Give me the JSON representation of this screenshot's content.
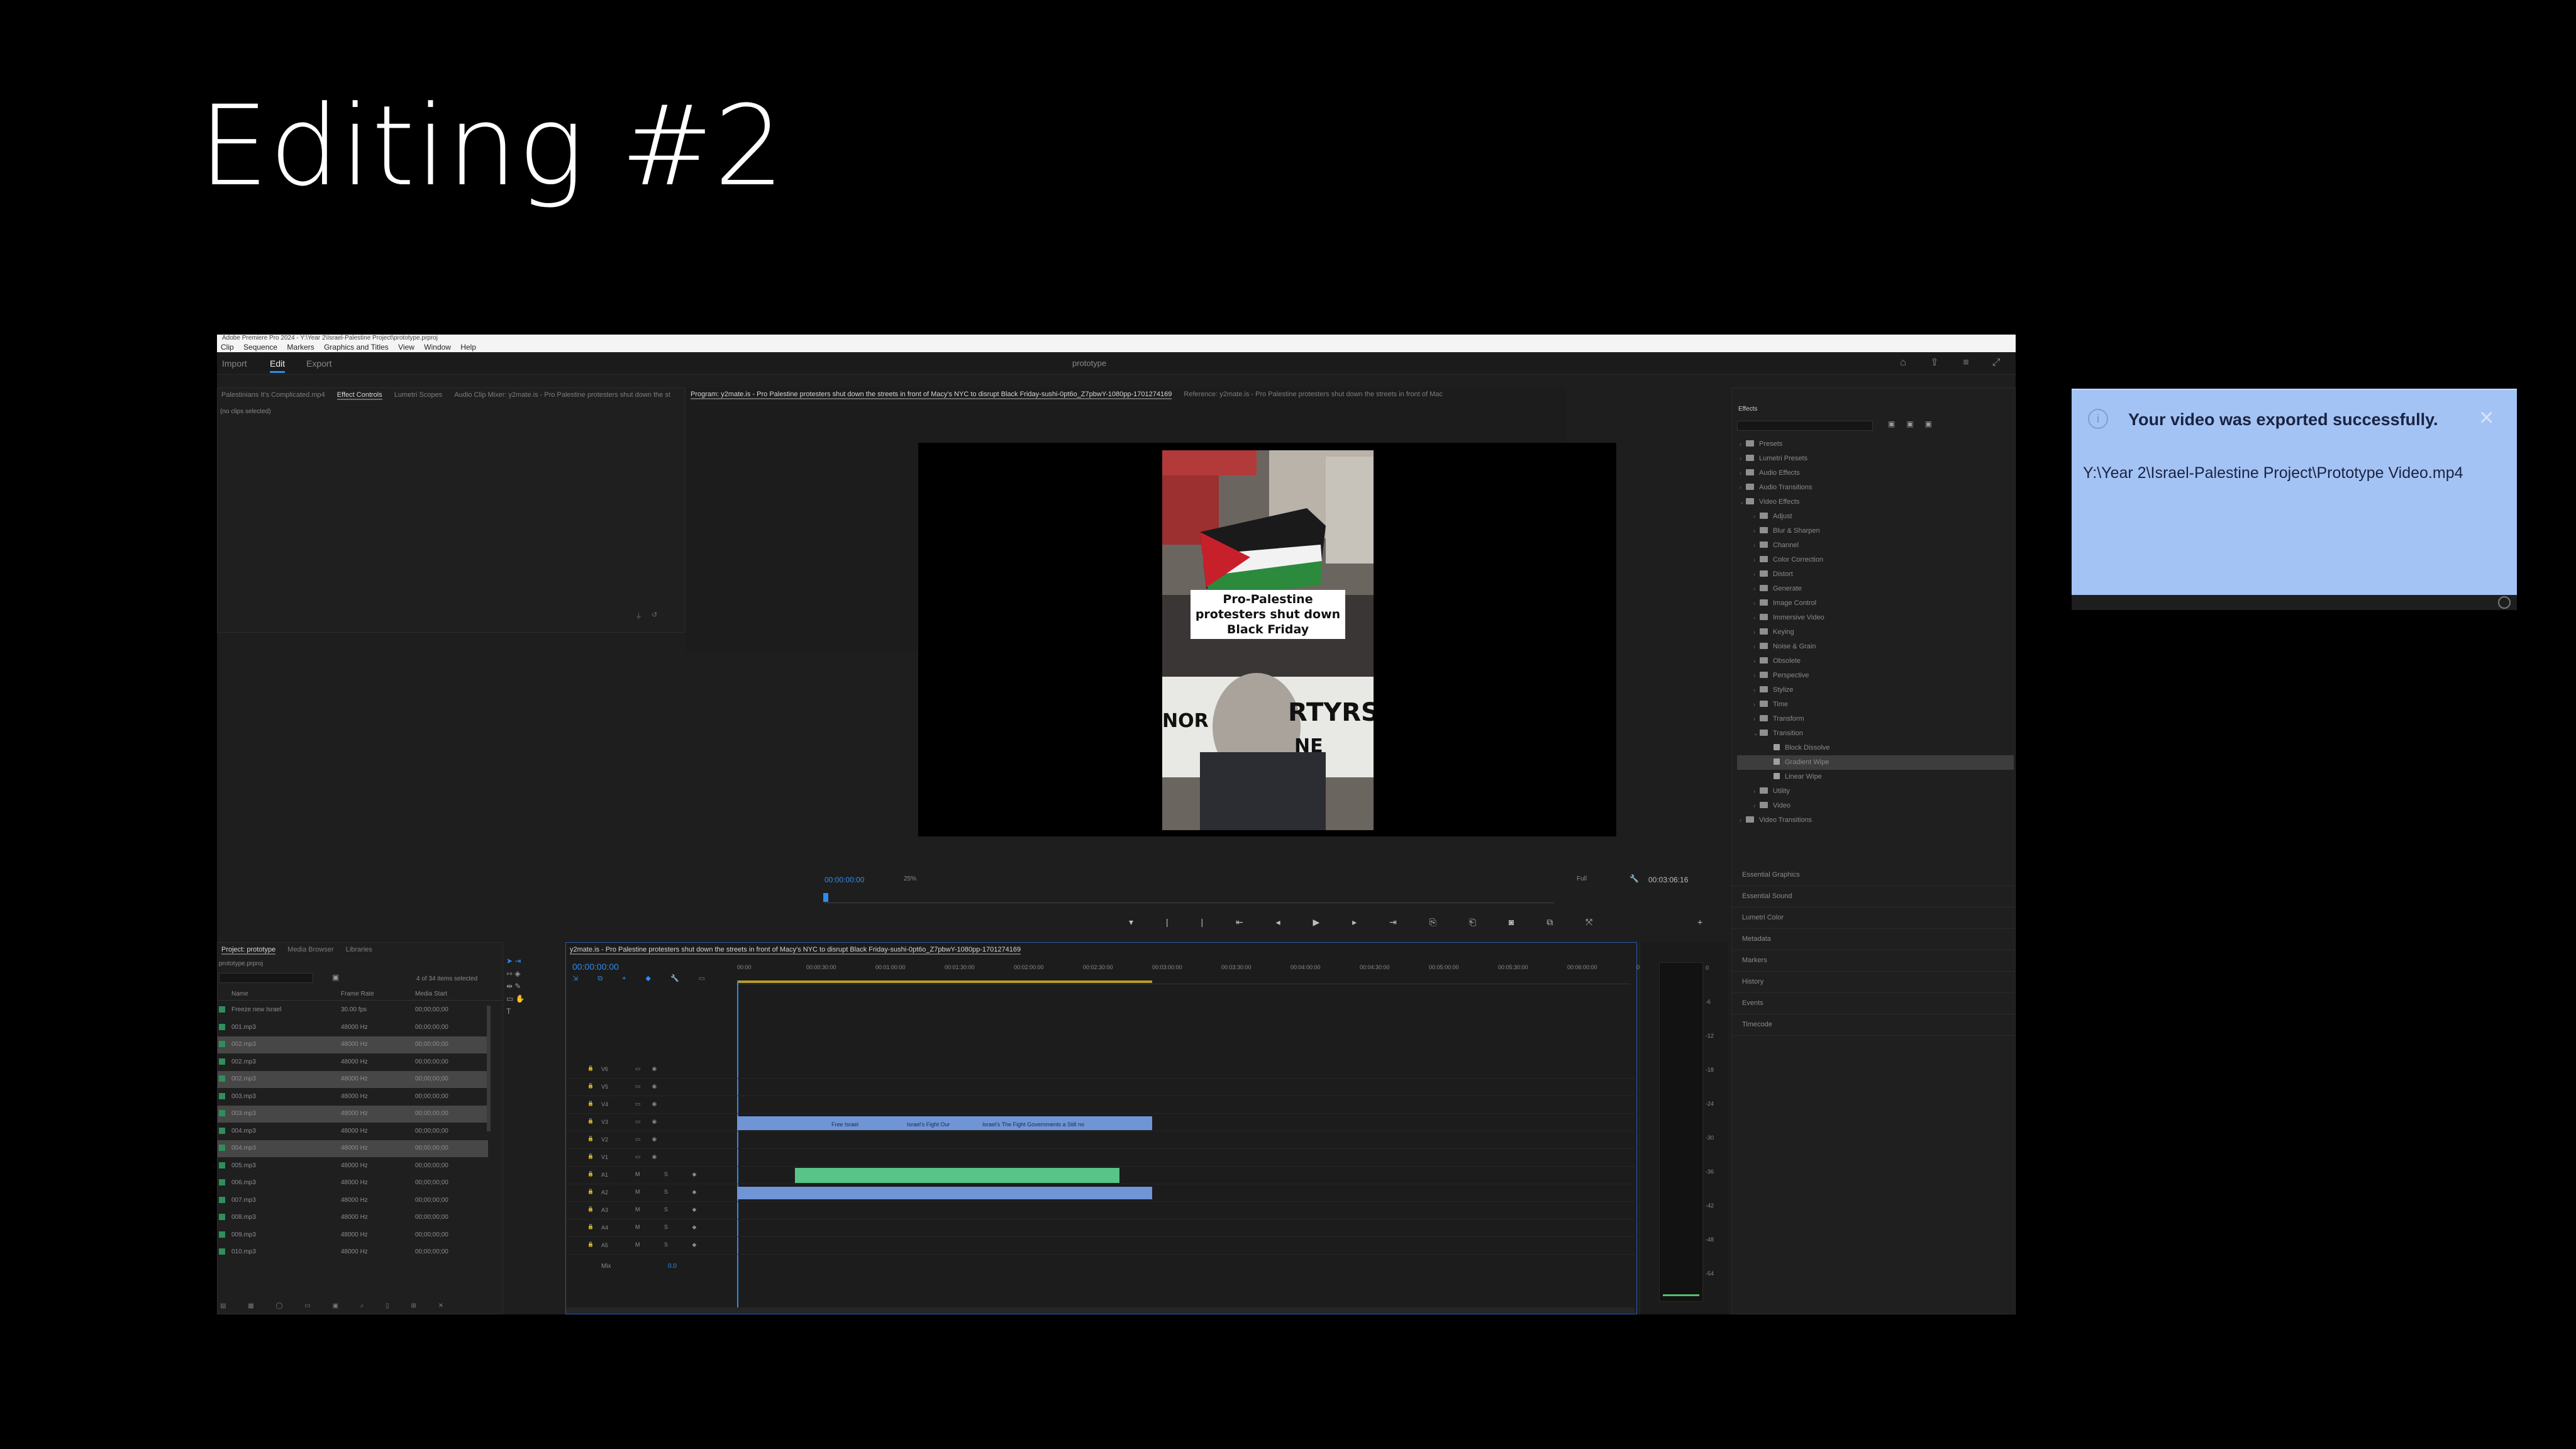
{
  "slide": {
    "title": "Editing #2"
  },
  "app": {
    "title_bar": "Adobe Premiere Pro 2024 - Y:\\Year 2\\Israel-Palestine Project\\prototype.prproj",
    "menu": [
      "Clip",
      "Sequence",
      "Markers",
      "Graphics and Titles",
      "View",
      "Window",
      "Help"
    ],
    "workspace_tabs": [
      "Import",
      "Edit",
      "Export"
    ],
    "active_workspace": "Edit",
    "project_name": "prototype"
  },
  "source_panel": {
    "tabs": [
      "Palestinians It's Complicated.mp4",
      "Effect Controls",
      "Lumetri Scopes",
      "Audio Clip Mixer: y2mate.is - Pro Palestine protesters shut down the st"
    ],
    "active_tab": "Effect Controls",
    "master_label": "(no clips selected)"
  },
  "program": {
    "tabs": [
      "Program: y2mate.is - Pro Palestine protesters shut down the streets in front of Macy's NYC to disrupt Black Friday-sushi-0pt6o_Z7pbwY-1080pp-1701274169",
      "Reference: y2mate.is - Pro Palestine protesters shut down the streets in front of Mac"
    ],
    "caption": "Pro-Palestine protesters shut down Black Friday",
    "timecode_current": "00:00:00:00",
    "zoom": "25%",
    "quality": "Full",
    "duration": "00:03:06:16"
  },
  "project_panel": {
    "tabs": [
      "Project: prototype",
      "Media Browser",
      "Libraries"
    ],
    "project_file": "prototype.prproj",
    "selection_info": "4 of 34 items selected",
    "columns": [
      "Name",
      "Frame Rate",
      "Media Start"
    ],
    "items": [
      {
        "name": "Freeze new Israel",
        "rate": "30.00 fps",
        "start": "00;00;00;00",
        "selected": false,
        "color": "#2f8f5b"
      },
      {
        "name": "001.mp3",
        "rate": "48000 Hz",
        "start": "00;00;00;00",
        "selected": false,
        "color": "#2f8f5b"
      },
      {
        "name": "002.mp3",
        "rate": "48000 Hz",
        "start": "00;00;00;00",
        "selected": true,
        "color": "#2f8f5b"
      },
      {
        "name": "002.mp3",
        "rate": "48000 Hz",
        "start": "00;00;00;00",
        "selected": false,
        "color": "#2f8f5b"
      },
      {
        "name": "002.mp3",
        "rate": "48000 Hz",
        "start": "00;00;00;00",
        "selected": true,
        "color": "#2f8f5b"
      },
      {
        "name": "003.mp3",
        "rate": "48000 Hz",
        "start": "00;00;00;00",
        "selected": false,
        "color": "#2f8f5b"
      },
      {
        "name": "003.mp3",
        "rate": "48000 Hz",
        "start": "00;00;00;00",
        "selected": true,
        "color": "#2f8f5b"
      },
      {
        "name": "004.mp3",
        "rate": "48000 Hz",
        "start": "00;00;00;00",
        "selected": false,
        "color": "#2f8f5b"
      },
      {
        "name": "004.mp3",
        "rate": "48000 Hz",
        "start": "00;00;00;00",
        "selected": true,
        "color": "#2f8f5b"
      },
      {
        "name": "005.mp3",
        "rate": "48000 Hz",
        "start": "00;00;00;00",
        "selected": false,
        "color": "#2f8f5b"
      },
      {
        "name": "006.mp3",
        "rate": "48000 Hz",
        "start": "00;00;00;00",
        "selected": false,
        "color": "#2f8f5b"
      },
      {
        "name": "007.mp3",
        "rate": "48000 Hz",
        "start": "00;00;00;00",
        "selected": false,
        "color": "#2f8f5b"
      },
      {
        "name": "008.mp3",
        "rate": "48000 Hz",
        "start": "00;00;00;00",
        "selected": false,
        "color": "#2f8f5b"
      },
      {
        "name": "009.mp3",
        "rate": "48000 Hz",
        "start": "00;00;00;00",
        "selected": false,
        "color": "#2f8f5b"
      },
      {
        "name": "010.mp3",
        "rate": "48000 Hz",
        "start": "00;00;00;00",
        "selected": false,
        "color": "#2f8f5b"
      }
    ]
  },
  "timeline": {
    "tab": "y2mate.is - Pro Palestine protesters shut down the streets in front of Macy's NYC to disrupt Black Friday-sushi-0pt6o_Z7pbwY-1080pp-1701274169",
    "timecode": "00:00:00:00",
    "ruler": [
      "00:00",
      "00:00:30:00",
      "00:01:00:00",
      "00:01:30:00",
      "00:02:00:00",
      "00:02:30:00",
      "00:03:00:00",
      "00:03:30:00",
      "00:04:00:00",
      "00:04:30:00",
      "00:05:00:00",
      "00:05:30:00",
      "00:06:00:00",
      "00:0"
    ],
    "video_tracks": [
      "V6",
      "V5",
      "V4",
      "V3",
      "V2",
      "V1"
    ],
    "audio_tracks": [
      "A1",
      "A2",
      "A3",
      "A4",
      "A5"
    ],
    "mix_label": "Mix",
    "mix_value": "0.0",
    "clip_labels": [
      "Free Israel",
      "Israel's Fight Our",
      "Israel's The Fight Governments a Still no"
    ],
    "clip_color_video": "#6f95d6",
    "clip_color_audio": "#58c488"
  },
  "effects": {
    "title": "Effects",
    "tree": [
      {
        "label": "Presets",
        "level": 0,
        "open": false
      },
      {
        "label": "Lumetri Presets",
        "level": 0,
        "open": false
      },
      {
        "label": "Audio Effects",
        "level": 0,
        "open": false
      },
      {
        "label": "Audio Transitions",
        "level": 0,
        "open": false
      },
      {
        "label": "Video Effects",
        "level": 0,
        "open": true
      },
      {
        "label": "Adjust",
        "level": 1,
        "open": false
      },
      {
        "label": "Blur & Sharpen",
        "level": 1,
        "open": false
      },
      {
        "label": "Channel",
        "level": 1,
        "open": false
      },
      {
        "label": "Color Correction",
        "level": 1,
        "open": false
      },
      {
        "label": "Distort",
        "level": 1,
        "open": false
      },
      {
        "label": "Generate",
        "level": 1,
        "open": false
      },
      {
        "label": "Image Control",
        "level": 1,
        "open": false
      },
      {
        "label": "Immersive Video",
        "level": 1,
        "open": false
      },
      {
        "label": "Keying",
        "level": 1,
        "open": false
      },
      {
        "label": "Noise & Grain",
        "level": 1,
        "open": false
      },
      {
        "label": "Obsolete",
        "level": 1,
        "open": false
      },
      {
        "label": "Perspective",
        "level": 1,
        "open": false
      },
      {
        "label": "Stylize",
        "level": 1,
        "open": false
      },
      {
        "label": "Time",
        "level": 1,
        "open": false
      },
      {
        "label": "Transform",
        "level": 1,
        "open": false
      },
      {
        "label": "Transition",
        "level": 1,
        "open": true
      },
      {
        "label": "Block Dissolve",
        "level": 2,
        "open": false
      },
      {
        "label": "Gradient Wipe",
        "level": 2,
        "open": false,
        "selected": true
      },
      {
        "label": "Linear Wipe",
        "level": 2,
        "open": false
      },
      {
        "label": "Utility",
        "level": 1,
        "open": false
      },
      {
        "label": "Video",
        "level": 1,
        "open": false
      },
      {
        "label": "Video Transitions",
        "level": 0,
        "open": false
      }
    ],
    "side_panels": [
      "Essential Graphics",
      "Essential Sound",
      "Lumetri Color",
      "Metadata",
      "Markers",
      "History",
      "Events",
      "Timecode"
    ]
  },
  "meter": {
    "labels": [
      "0",
      "-6",
      "-12",
      "-18",
      "-24",
      "-30",
      "-36",
      "-42",
      "-48",
      "-54"
    ]
  },
  "toast": {
    "message": "Your video was exported successfully.",
    "path": "Y:\\Year 2\\Israel-Palestine Project\\Prototype Video.mp4",
    "close_icon": "close-icon",
    "info_icon": "info-icon",
    "background": "#a3c3f5"
  }
}
